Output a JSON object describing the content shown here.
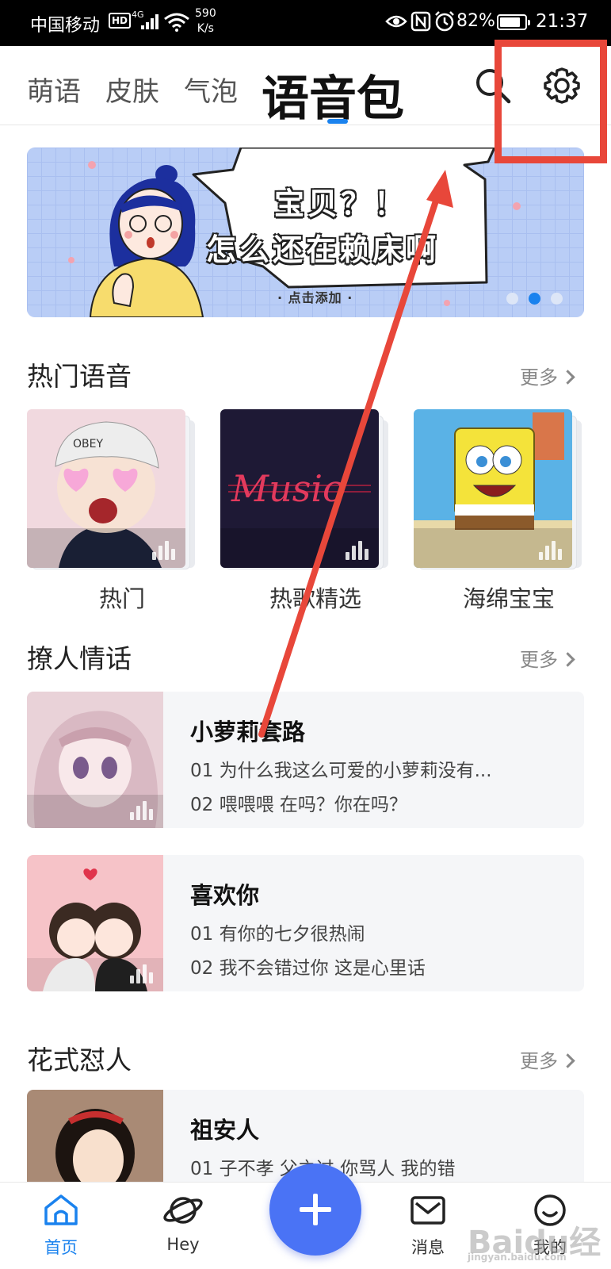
{
  "status_bar": {
    "carrier": "中国移动",
    "hd": "HD",
    "network": "4G",
    "speed_value": "590",
    "speed_unit": "K/s",
    "battery_percent": "82%",
    "battery_level": 0.82,
    "time": "21:37"
  },
  "top_nav": {
    "tabs": [
      {
        "label": "萌语"
      },
      {
        "label": "皮肤"
      },
      {
        "label": "气泡"
      },
      {
        "label": "语音包",
        "active": true
      }
    ]
  },
  "banner": {
    "line1": "宝贝？！",
    "line2": "怎么还在赖床啊",
    "cta": "· 点击添加 ·",
    "dot_count": 3,
    "active_dot": 1
  },
  "sections": {
    "hot": {
      "title": "热门语音",
      "more": "更多",
      "albums": [
        {
          "label": "热门",
          "icon": "cartoon-boy-cover"
        },
        {
          "label": "热歌精选",
          "icon": "music-cover"
        },
        {
          "label": "海绵宝宝",
          "icon": "spongebob-cover"
        }
      ]
    },
    "flirt": {
      "title": "撩人情话",
      "more": "更多",
      "items": [
        {
          "title": "小萝莉套路",
          "line1": "01 为什么我这么可爱的小萝莉没有...",
          "line2": "02 喂喂喂 在吗？你在吗？"
        },
        {
          "title": "喜欢你",
          "line1": "01 有你的七夕很热闹",
          "line2": "02 我不会错过你 这是心里话"
        }
      ]
    },
    "roast": {
      "title": "花式怼人",
      "more": "更多",
      "items": [
        {
          "title": "祖安人",
          "line1": "01 子不孝 父之过 你骂人 我的错"
        }
      ]
    }
  },
  "bottom_nav": {
    "items": [
      {
        "label": "首页",
        "active": true
      },
      {
        "label": "Hey"
      },
      {
        "label": "消息"
      },
      {
        "label": "我的"
      }
    ]
  },
  "cover_art_text": "Music",
  "watermark": "Baidu经验",
  "watermark_url": "jingyan.baidu.com",
  "colors": {
    "accent": "#1a82ee",
    "add_button": "#4a73f5",
    "annotation": "#e8473a",
    "banner_bg": "#b9cdf6"
  }
}
